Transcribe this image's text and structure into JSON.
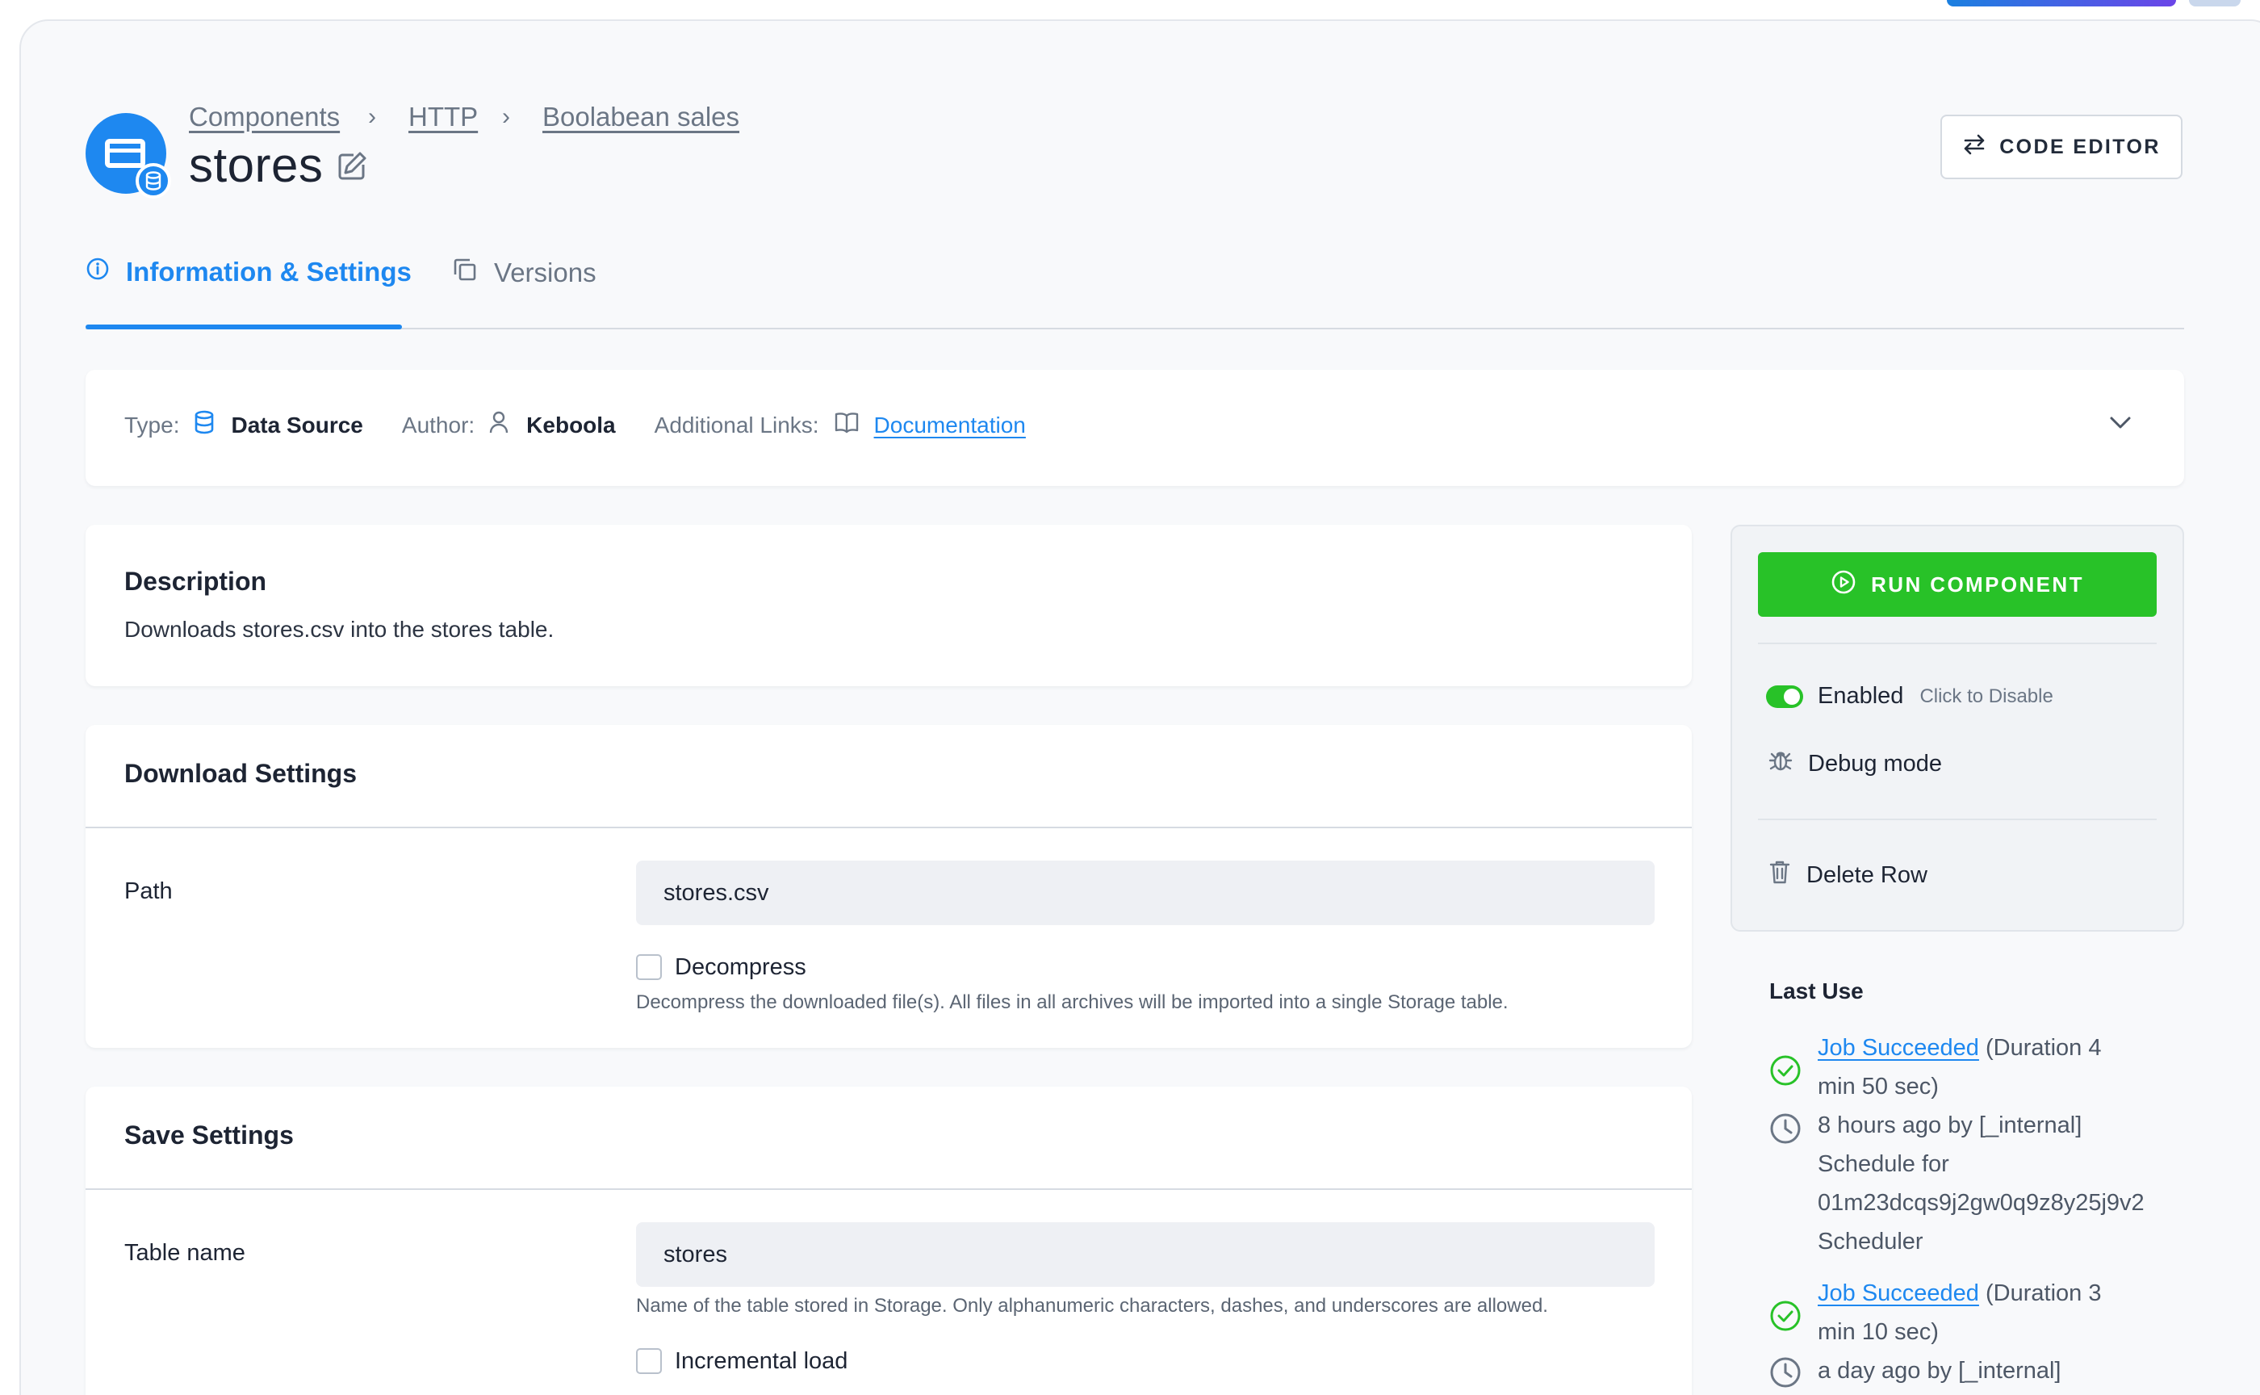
{
  "breadcrumb": [
    "Components",
    "HTTP",
    "Boolabean sales"
  ],
  "breadcrumb_separator": "›",
  "page_title": "stores",
  "header": {
    "code_editor_label": "CODE EDITOR"
  },
  "tabs": [
    {
      "label": "Information & Settings",
      "active": true
    },
    {
      "label": "Versions",
      "active": false
    }
  ],
  "info": {
    "type_label": "Type:",
    "type_value": "Data Source",
    "author_label": "Author:",
    "author_value": "Keboola",
    "links_label": "Additional Links:",
    "links_value": "Documentation"
  },
  "description": {
    "title": "Description",
    "text": "Downloads stores.csv into the stores table."
  },
  "download_settings": {
    "title": "Download Settings",
    "path_label": "Path",
    "path_value": "stores.csv",
    "decompress_label": "Decompress",
    "decompress_checked": false,
    "decompress_help": "Decompress the downloaded file(s). All files in all archives will be imported into a single Storage table."
  },
  "save_settings": {
    "title": "Save Settings",
    "table_name_label": "Table name",
    "table_name_value": "stores",
    "table_name_help": "Name of the table stored in Storage. Only alphanumeric characters, dashes, and underscores are allowed.",
    "incremental_label": "Incremental load",
    "incremental_checked": false
  },
  "side_panel": {
    "run_label": "RUN COMPONENT",
    "enabled_label": "Enabled",
    "enabled_hint": "Click to Disable",
    "enabled": true,
    "debug_label": "Debug mode",
    "delete_label": "Delete Row"
  },
  "last_use": {
    "title": "Last Use",
    "jobs": [
      {
        "status": "Job Succeeded",
        "duration_a": "(Duration 4",
        "duration_b": "min 50 sec)",
        "when": "8 hours ago by [_internal]",
        "schedule_a": "Schedule for",
        "schedule_b": "01m23dcqs9j2gw0q9z8y25j9v2",
        "schedule_c": "Scheduler"
      },
      {
        "status": "Job Succeeded",
        "duration_a": "(Duration 3",
        "duration_b": "min 10 sec)",
        "when": "a day ago by [_internal]"
      }
    ]
  },
  "colors": {
    "accent": "#1e88f0",
    "success": "#28c228",
    "text": "#1d2433",
    "muted": "#6b7685"
  }
}
